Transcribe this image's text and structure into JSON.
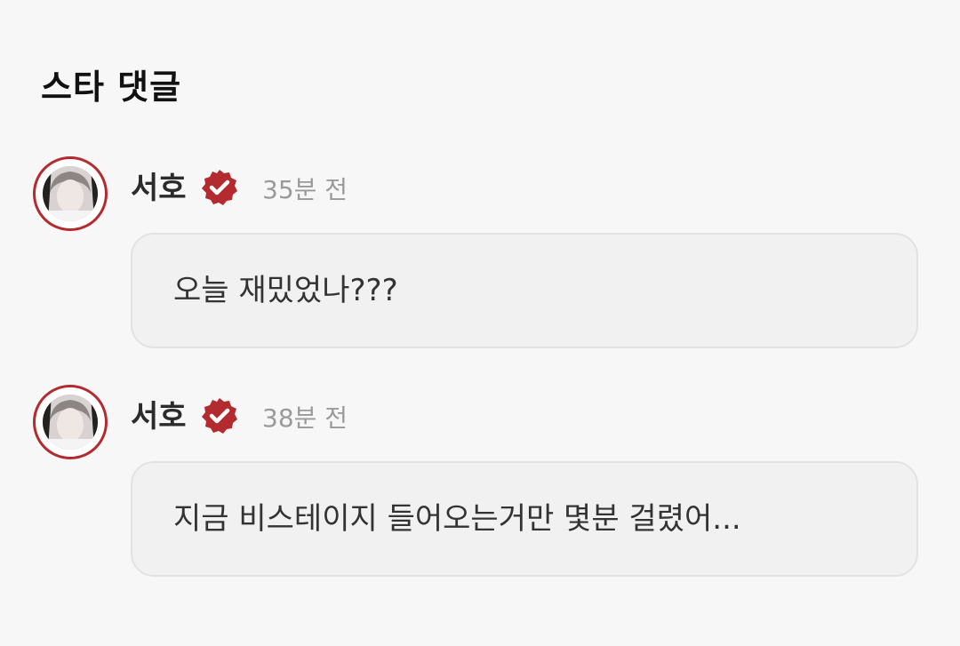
{
  "section": {
    "title": "스타 댓글"
  },
  "comments": [
    {
      "author": "서호",
      "verified_icon": "verified-badge-icon",
      "time": "35분 전",
      "text": "오늘 재밌었나???"
    },
    {
      "author": "서호",
      "verified_icon": "verified-badge-icon",
      "time": "38분 전",
      "text": "지금 비스테이지 들어오는거만 몇분 걸렸어..."
    }
  ],
  "colors": {
    "background": "#f7f7f7",
    "accent": "#b32a2f",
    "bubble": "#f1f1f1",
    "timestamp": "#9a9a9a"
  }
}
